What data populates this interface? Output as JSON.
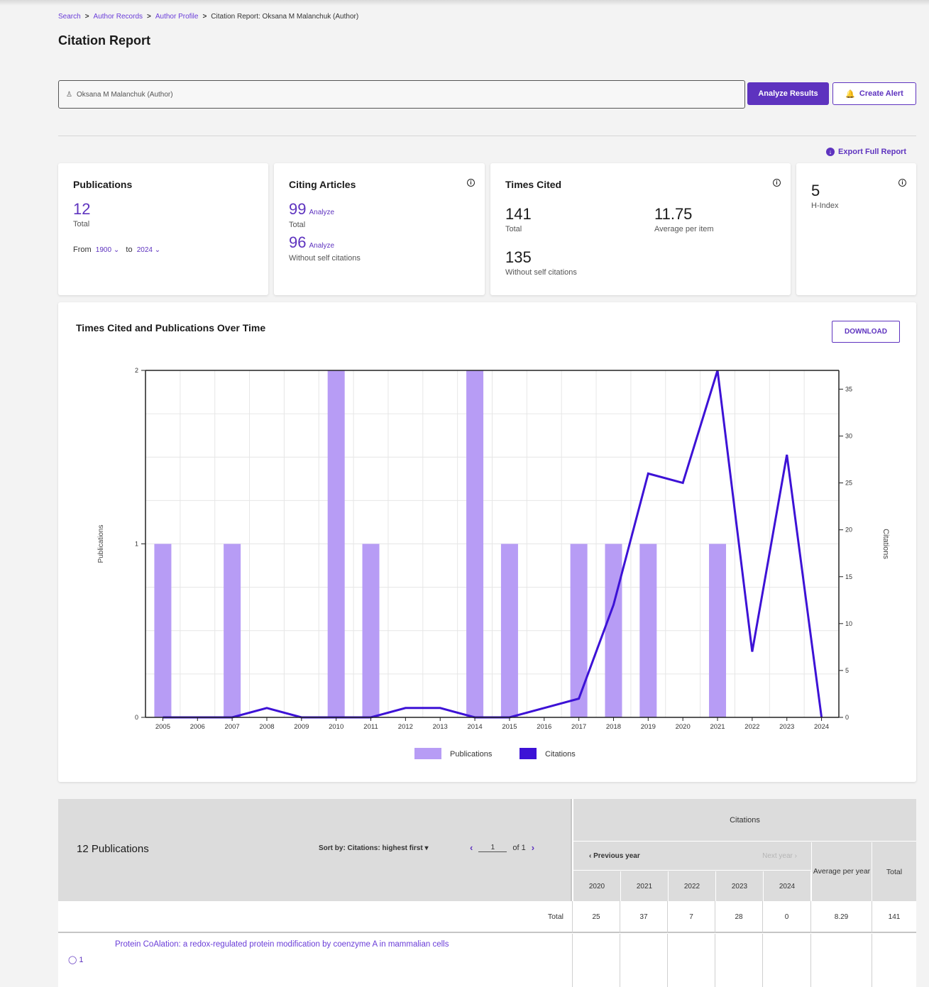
{
  "breadcrumb": {
    "search": "Search",
    "author_records": "Author Records",
    "author_profile": "Author Profile",
    "current": "Citation Report: Oksana M Malanchuk (Author)",
    "sep": ">"
  },
  "page_title": "Citation Report",
  "search": {
    "query": "Oksana M Malanchuk (Author)"
  },
  "buttons": {
    "analyze": "Analyze Results",
    "create_alert": "Create Alert",
    "export": "Export Full Report",
    "download": "DOWNLOAD"
  },
  "publications_card": {
    "title": "Publications",
    "total": "12",
    "total_label": "Total",
    "from_label": "From",
    "from_value": "1900",
    "to_label": "to",
    "to_value": "2024"
  },
  "citing_card": {
    "title": "Citing Articles",
    "total": "99",
    "analyze": "Analyze",
    "total_label": "Total",
    "without_self": "96",
    "without_self_label": "Without self citations"
  },
  "times_cited_card": {
    "title": "Times Cited",
    "total": "141",
    "total_label": "Total",
    "average": "11.75",
    "average_label": "Average per item",
    "without_self": "135",
    "without_self_label": "Without self citations"
  },
  "h_index_card": {
    "value": "5",
    "label": "H-Index"
  },
  "chart": {
    "title": "Times Cited and Publications Over Time",
    "legend_publications": "Publications",
    "legend_citations": "Citations",
    "ylabel_left": "Publications",
    "ylabel_right": "Citations"
  },
  "chart_data": {
    "type": "bar",
    "title": "Times Cited and Publications Over Time",
    "categories": [
      "2005",
      "2006",
      "2007",
      "2008",
      "2009",
      "2010",
      "2011",
      "2012",
      "2013",
      "2014",
      "2015",
      "2016",
      "2017",
      "2018",
      "2019",
      "2020",
      "2021",
      "2022",
      "2023",
      "2024"
    ],
    "series": [
      {
        "name": "Publications",
        "type": "bar",
        "axis": "left",
        "color": "#b79cf5",
        "values": [
          1,
          0,
          1,
          0,
          0,
          2,
          1,
          0,
          0,
          2,
          1,
          0,
          1,
          1,
          1,
          0,
          1,
          0,
          0,
          0
        ]
      },
      {
        "name": "Citations",
        "type": "line",
        "axis": "right",
        "color": "#3d12d6",
        "values": [
          0,
          0,
          0,
          1,
          0,
          0,
          0,
          1,
          1,
          0,
          0,
          1,
          2,
          12,
          26,
          25,
          37,
          7,
          28,
          0
        ]
      }
    ],
    "ylabel": "Publications",
    "ylabel_right": "Citations",
    "ylim": [
      0,
      2
    ],
    "ylim_right": [
      0,
      37
    ],
    "yticks_left": [
      0,
      1,
      2
    ],
    "yticks_right": [
      0,
      5,
      10,
      15,
      20,
      25,
      30,
      35
    ],
    "grid": true,
    "legend": "bottom-center"
  },
  "table": {
    "count_label": "12 Publications",
    "sort_label": "Sort by: Citations: highest first",
    "page": "1",
    "of_label": "of 1",
    "citations_header": "Citations",
    "prev_year": "Previous year",
    "next_year": "Next year",
    "years": [
      "2020",
      "2021",
      "2022",
      "2023",
      "2024"
    ],
    "avg_header": "Average per year",
    "total_header": "Total",
    "total_row_label": "Total",
    "totals": [
      "25",
      "37",
      "7",
      "28",
      "0"
    ],
    "avg_total": "8.29",
    "grand_total": "141",
    "rows": [
      {
        "num": "1",
        "title": "Protein CoAlation: a redox-regulated protein modification by coenzyme A in mammalian cells"
      }
    ]
  },
  "colors": {
    "accent": "#5e33bf",
    "bar": "#b79cf5",
    "line": "#3d12d6"
  }
}
